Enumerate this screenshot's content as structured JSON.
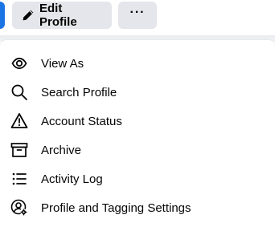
{
  "toolbar": {
    "edit_profile_label": "Edit Profile",
    "more_label": "···",
    "edit_icon": "pencil-icon",
    "accent_color": "#1b74e4",
    "button_bg": "#e4e6eb"
  },
  "menu": {
    "items": [
      {
        "label": "View As",
        "icon": "eye-icon"
      },
      {
        "label": "Search Profile",
        "icon": "search-icon"
      },
      {
        "label": "Account Status",
        "icon": "warning-icon"
      },
      {
        "label": "Archive",
        "icon": "archive-box-icon"
      },
      {
        "label": "Activity Log",
        "icon": "list-icon"
      },
      {
        "label": "Profile and Tagging Settings",
        "icon": "profile-settings-icon"
      }
    ]
  }
}
